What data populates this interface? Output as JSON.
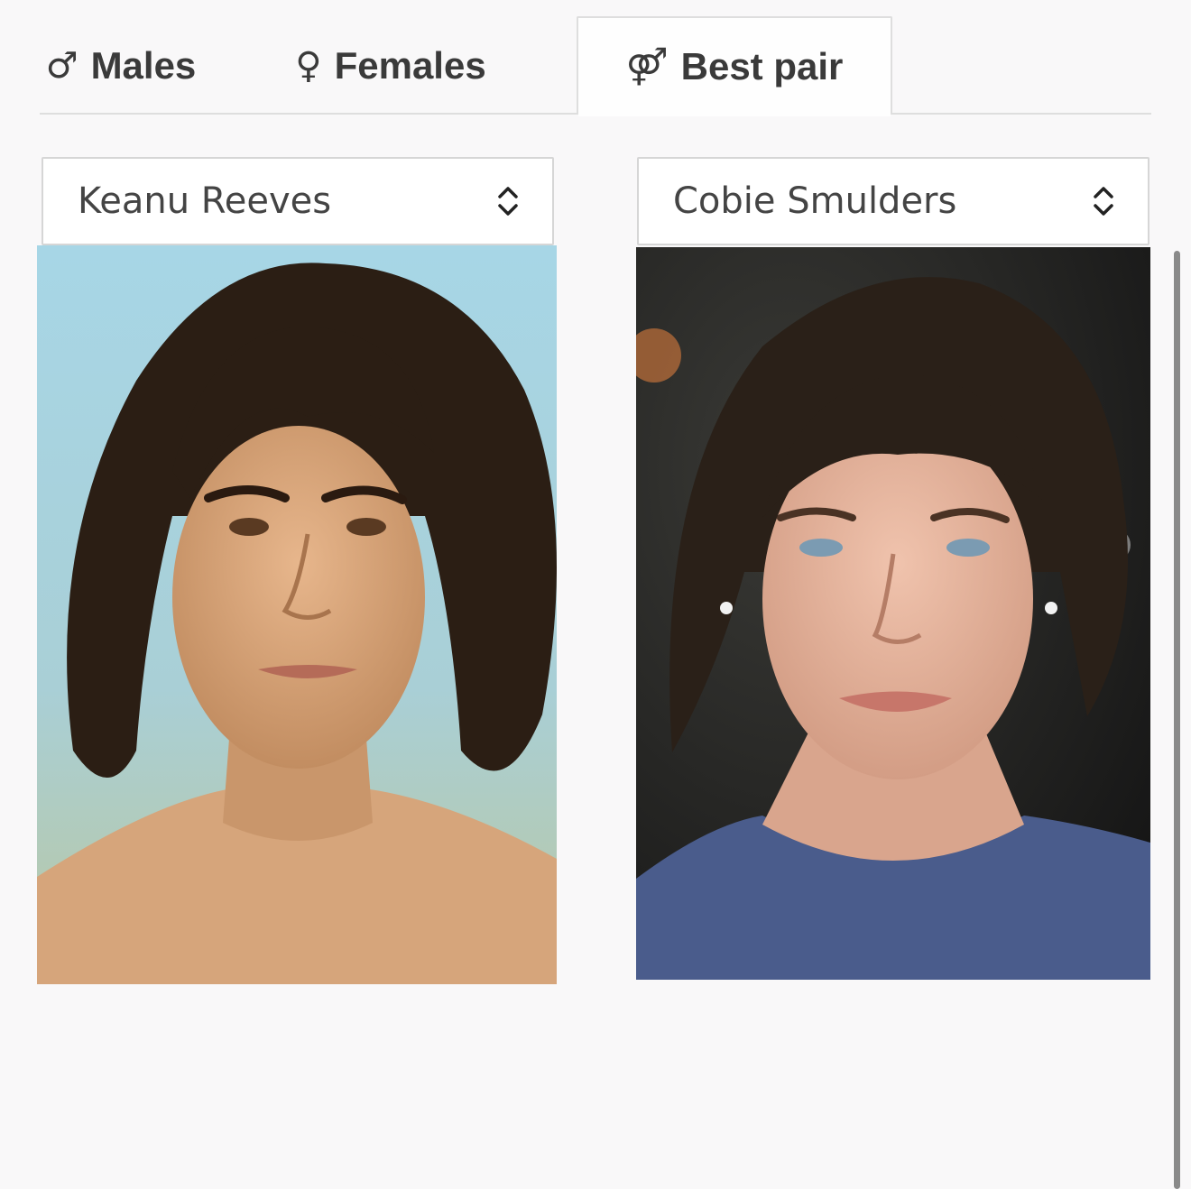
{
  "tabs": [
    {
      "symbol": "♂",
      "label": "Males",
      "icon": "male-symbol-icon",
      "active": false
    },
    {
      "symbol": "♀",
      "label": "Females",
      "icon": "female-symbol-icon",
      "active": false
    },
    {
      "symbol": "⚤",
      "label": "Best pair",
      "icon": "couple-symbol-icon",
      "active": true
    }
  ],
  "selectors": {
    "male": {
      "value": "Keanu Reeves",
      "icon": "updown-chevron-icon"
    },
    "female": {
      "value": "Cobie Smulders",
      "icon": "updown-chevron-icon"
    }
  },
  "photos": {
    "male": {
      "subject": "portrait photo",
      "background_color": "#9fcfe0"
    },
    "female": {
      "subject": "portrait photo",
      "background_color": "#2a2a2a"
    }
  },
  "colors": {
    "page_background": "#f9f8f9",
    "tab_text": "#3a3a3a",
    "border": "#dedede"
  }
}
